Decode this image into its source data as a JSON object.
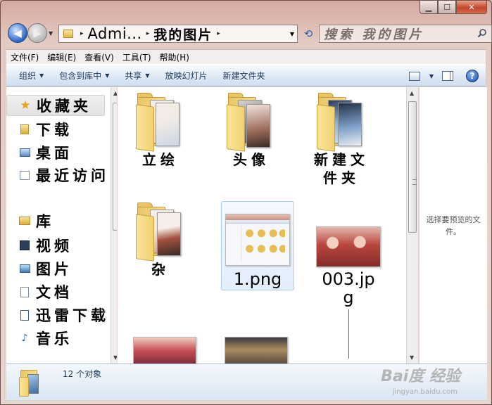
{
  "window": {
    "caption_minimize": "▁",
    "caption_maximize": "☐",
    "caption_close": "✕"
  },
  "address_bar": {
    "root": "Admi...",
    "current": "我的图片",
    "separator": "▸"
  },
  "search": {
    "placeholder": "搜索 我的图片"
  },
  "menu": [
    "文件(F)",
    "编辑(E)",
    "查看(V)",
    "工具(T)",
    "帮助(H)"
  ],
  "toolbar": {
    "organize": "组织",
    "include_in_library": "包含到库中",
    "share": "共享",
    "slideshow": "放映幻灯片",
    "new_folder": "新建文件夹",
    "help": "?"
  },
  "nav_pane": {
    "favorites": "收藏夹",
    "downloads": "下载",
    "desktop": "桌面",
    "recent": "最近访问",
    "libraries": "库",
    "videos": "视频",
    "pictures": "图片",
    "documents": "文档",
    "thunder": "迅雷下载",
    "music": "音乐"
  },
  "files": [
    {
      "name": "立绘",
      "kind": "folder"
    },
    {
      "name": "头像",
      "kind": "folder"
    },
    {
      "name": "新建文件夹",
      "kind": "folder"
    },
    {
      "name": "杂",
      "kind": "folder"
    },
    {
      "name": "1.png",
      "kind": "image",
      "selected": true
    },
    {
      "name": "003.jpg",
      "kind": "image"
    }
  ],
  "file_labels": {
    "f0": "立绘",
    "f1": "头像",
    "f2a": "新建文",
    "f2b": "件夹",
    "f3": "杂",
    "f4": "1.png",
    "f5a": "003.jp",
    "f5b": "g"
  },
  "preview_pane": {
    "message": "选择要预览的文件。"
  },
  "status": {
    "count": "12 个对象"
  },
  "watermark": {
    "brand": "Bai度 经验",
    "url": "jingyan.baidu.com"
  },
  "colors": {
    "folder": "#f2d170",
    "toolbar_text": "#1e395b",
    "selection": "#a8cbef"
  }
}
